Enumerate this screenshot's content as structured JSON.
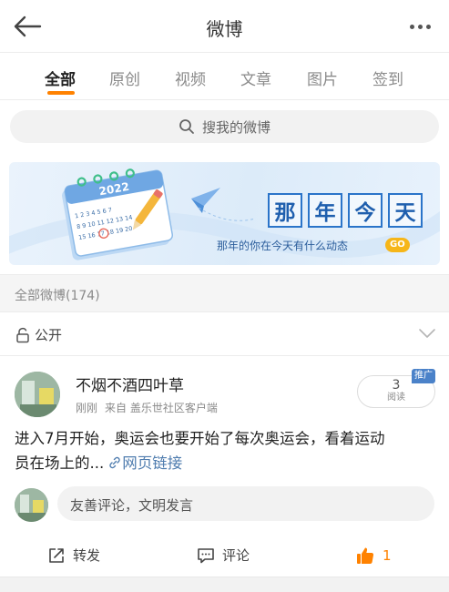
{
  "header": {
    "title": "微博",
    "back_icon": "arrow-left-icon",
    "more_icon": "more-dots-icon"
  },
  "tabs": [
    {
      "label": "全部",
      "active": true
    },
    {
      "label": "原创"
    },
    {
      "label": "视频"
    },
    {
      "label": "文章"
    },
    {
      "label": "图片"
    },
    {
      "label": "签到"
    }
  ],
  "search": {
    "placeholder": "搜我的微博",
    "icon": "search-icon"
  },
  "banner": {
    "calendar_year": "2022",
    "calendar_dates": "1 2 3 4 5 6 7 8 9 10 11 12 13 14 15 16 17 18 19 20",
    "title_chars": [
      "那",
      "年",
      "今",
      "天"
    ],
    "subtitle": "那年的你在今天有什么动态",
    "go_label": "GO"
  },
  "count_bar": {
    "text": "全部微博(174)"
  },
  "filter": {
    "label": "公开",
    "icon": "lock-icon",
    "chevron": "chevron-down-icon"
  },
  "post": {
    "author": "不烟不酒四叶草",
    "time": "刚刚",
    "source": "来自 盖乐世社区客户端",
    "read_count": "3",
    "read_label": "阅读",
    "promo_label": "推广",
    "text_line1": "进入7月开始，奥运会也要开始了每次奥运会，看着运动",
    "text_line2_prefix": "员在场上的...",
    "link_label": "网页链接"
  },
  "comment": {
    "placeholder": "友善评论，文明发言"
  },
  "actions": {
    "repost_label": "转发",
    "comment_label": "评论",
    "like_count": "1"
  },
  "colors": {
    "accent": "#ff8200",
    "link": "#507daf",
    "banner_blue": "#2a74c9",
    "go_badge": "#f6b619"
  }
}
